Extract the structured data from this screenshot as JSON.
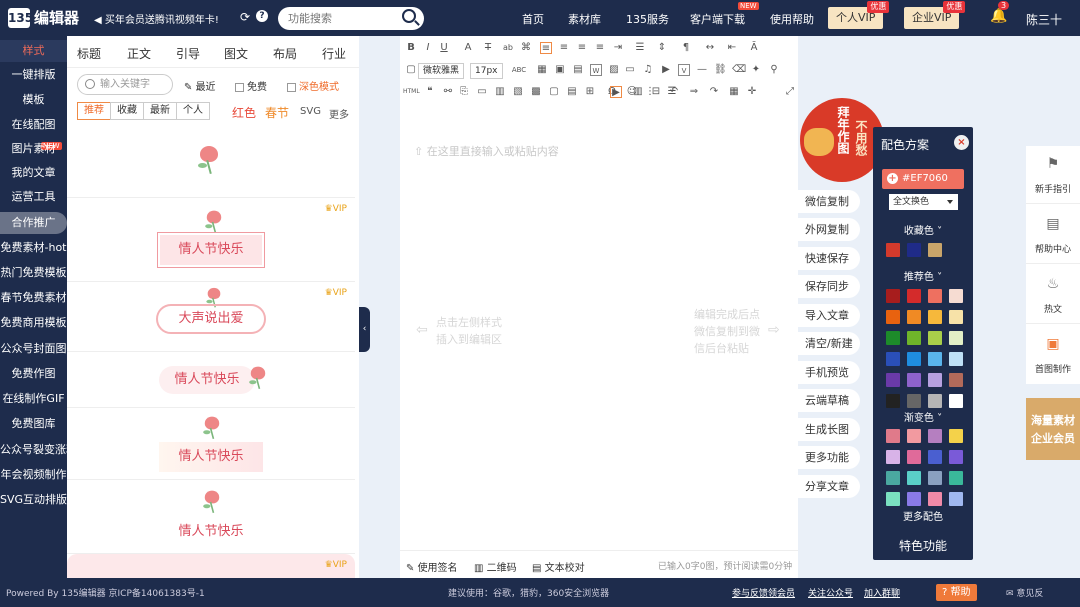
{
  "header": {
    "logo_mark": "135",
    "logo_text": "编辑器",
    "promo": "买年会员送腾讯视频年卡!",
    "search_placeholder": "功能搜索",
    "nav": [
      {
        "label": "首页"
      },
      {
        "label": "素材库"
      },
      {
        "label": "135服务"
      },
      {
        "label": "客户端下载",
        "badge": "NEW"
      },
      {
        "label": "使用帮助"
      }
    ],
    "vip_personal": "个人VIP",
    "vip_enterprise": "企业VIP",
    "vip_tag": "优惠",
    "notifications": "3",
    "username": "陈三十"
  },
  "sidebar": {
    "items": [
      {
        "label": "样式"
      },
      {
        "label": "一键排版"
      },
      {
        "label": "模板"
      },
      {
        "label": "在线配图"
      },
      {
        "label": "图片素材"
      },
      {
        "label": "我的文章"
      },
      {
        "label": "运营工具"
      },
      {
        "label": "合作推广"
      },
      {
        "label": "免费素材-hot"
      },
      {
        "label": "热门免费模板"
      },
      {
        "label": "春节免费素材"
      },
      {
        "label": "免费商用模板"
      },
      {
        "label": "公众号封面图"
      },
      {
        "label": "免费作图"
      },
      {
        "label": "在线制作GIF"
      },
      {
        "label": "免费图库"
      },
      {
        "label": "公众号裂变涨粉"
      },
      {
        "label": "年会视频制作"
      },
      {
        "label": "SVG互动排版"
      }
    ],
    "new_badge": "NEW"
  },
  "panel": {
    "tabs": [
      "标题",
      "正文",
      "引导",
      "图文",
      "布局",
      "行业"
    ],
    "search_placeholder": "输入关键字",
    "opt_recent": "最近",
    "opt_free": "免费",
    "opt_dark": "深色模式",
    "filters": [
      "推荐",
      "收藏",
      "最新",
      "个人"
    ],
    "word_red": "红色",
    "word_spring": "春节",
    "word_svg": "SVG",
    "word_more": "更多",
    "vip_label": "VIP",
    "cards": [
      {
        "title": ""
      },
      {
        "title": "情人节快乐"
      },
      {
        "title": "大声说出爱"
      },
      {
        "title": "情人节快乐"
      },
      {
        "title": "情人节快乐"
      },
      {
        "title": "情人节快乐"
      }
    ]
  },
  "editor": {
    "font": "微软雅黑",
    "size": "17px",
    "placeholder": "在这里直接输入或粘贴内容",
    "hint_left_1": "点击左侧样式",
    "hint_left_2": "插入到编辑区",
    "hint_right_1": "编辑完成后点",
    "hint_right_2": "微信复制到微",
    "hint_right_3": "信后台粘贴",
    "bottom_sign": "使用签名",
    "bottom_qr": "二维码",
    "bottom_check": "文本校对",
    "bottom_count": "已输入0字0图，预计阅读需0分钟"
  },
  "actions": [
    "微信复制",
    "外网复制",
    "快速保存",
    "保存同步",
    "导入文章",
    "清空/新建",
    "手机预览",
    "云端草稿",
    "生成长图",
    "更多功能",
    "分享文章"
  ],
  "greeting": {
    "line1": "拜年作图",
    "line2": "不用愁"
  },
  "colorpanel": {
    "title": "配色方案",
    "close": "×",
    "hex": "#EF7060",
    "select": "全文换色",
    "fav_label": "收藏色",
    "fav_colors": [
      "#d33a2c",
      "#1f2b88",
      "#c9a56a"
    ],
    "rec_label": "推荐色",
    "rec_colors": [
      "#a71d1d",
      "#d42b2b",
      "#ee7060",
      "#f6dcd2",
      "#e8620f",
      "#f08a24",
      "#f6b83b",
      "#f7e2a8",
      "#1d8b2a",
      "#6fb52a",
      "#a9cf4a",
      "#e2efc6",
      "#2a4fb8",
      "#1f8de0",
      "#5ab4ec",
      "#bfe0f6",
      "#6a3aa8",
      "#8e63cc",
      "#b6a1e0",
      "#b26a5a",
      "#222222",
      "#666666",
      "#b5b5b5",
      "#ffffff"
    ],
    "grad_label": "渐变色",
    "grad_colors": [
      "#e07a8a",
      "#f29aa0",
      "#b57fc0",
      "#f4d24a",
      "#d8b3e8",
      "#e06a9a",
      "#4a5fd0",
      "#7a5ad8",
      "#4aa8a0",
      "#5ad0c8",
      "#8aa0c0",
      "#3ab89a",
      "#7ae0c0",
      "#8a7ae8",
      "#f08aa8",
      "#a0b8f0"
    ],
    "more": "更多配色",
    "special": "特色功能"
  },
  "rightbar": [
    {
      "label": "新手指引",
      "icon": "signpost-icon"
    },
    {
      "label": "帮助中心",
      "icon": "book-icon"
    },
    {
      "label": "热文",
      "icon": "flame-icon"
    },
    {
      "label": "首图制作",
      "icon": "image-icon"
    }
  ],
  "rightbar_promo": {
    "line1": "海量素材",
    "line2": "企业会员"
  },
  "footer": {
    "powered": "Powered By 135编辑器 京ICP备14061383号-1",
    "suggest": "建议使用：谷歌，猎豹，360安全浏览器",
    "feedback": "参与反馈领会员",
    "follow": "关注公众号",
    "group": "加入群聊",
    "help": "帮助",
    "opinion": "意见反"
  }
}
